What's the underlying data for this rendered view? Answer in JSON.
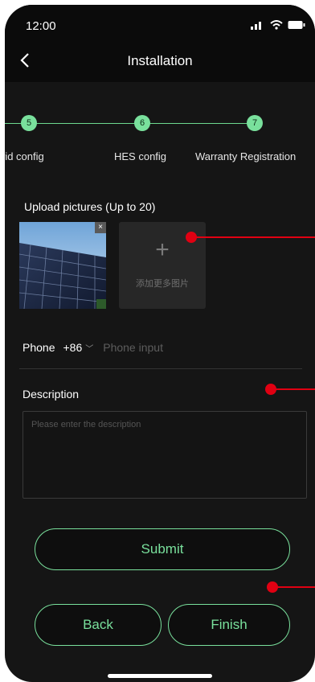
{
  "status_bar": {
    "time": "12:00",
    "icons": [
      "signal-icon",
      "wifi-icon",
      "battery-icon"
    ]
  },
  "nav": {
    "title": "Installation",
    "back_icon": "chevron-left-icon"
  },
  "steps": [
    {
      "number": "5",
      "label": "rid config"
    },
    {
      "number": "6",
      "label": "HES config"
    },
    {
      "number": "7",
      "label": "Warranty Registration"
    }
  ],
  "upload": {
    "title": "Upload pictures (Up to 20)",
    "add_plus": "+",
    "add_label": "添加更多图片",
    "remove_glyph": "×"
  },
  "phone": {
    "label": "Phone",
    "country_code": "+86",
    "chevron": "﹀",
    "placeholder": "Phone input",
    "value": ""
  },
  "description": {
    "label": "Description",
    "placeholder": "Please enter the description",
    "value": ""
  },
  "buttons": {
    "submit": "Submit",
    "back": "Back",
    "finish": "Finish"
  },
  "colors": {
    "accent": "#79e09c",
    "background": "#151515",
    "annotation": "#e00012"
  }
}
